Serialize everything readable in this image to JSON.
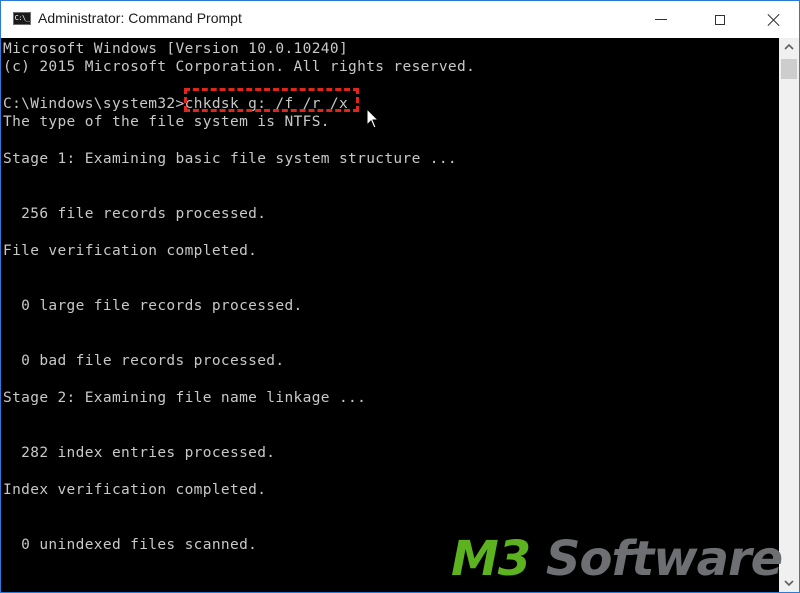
{
  "window": {
    "title": "Administrator: Command Prompt",
    "icon": "cmd-icon",
    "icon_text": "C:\\_",
    "controls": {
      "minimize": "minimize-icon",
      "maximize": "maximize-icon",
      "close": "close-icon"
    }
  },
  "console": {
    "lines": [
      "Microsoft Windows [Version 10.0.10240]",
      "(c) 2015 Microsoft Corporation. All rights reserved.",
      "",
      "C:\\Windows\\system32>chkdsk g: /f /r /x",
      "The type of the file system is NTFS.",
      "",
      "Stage 1: Examining basic file system structure ...",
      "",
      "",
      "  256 file records processed.",
      "",
      "File verification completed.",
      "",
      "",
      "  0 large file records processed.",
      "",
      "",
      "  0 bad file records processed.",
      "",
      "Stage 2: Examining file name linkage ...",
      "",
      "",
      "  282 index entries processed.",
      "",
      "Index verification completed.",
      "",
      "",
      "  0 unindexed files scanned."
    ],
    "prompt": "C:\\Windows\\system32>",
    "command": "chkdsk g: /f /r /x",
    "highlight_color": "#e0251b",
    "text_color": "#c8c8c8",
    "background_color": "#000000"
  },
  "scrollbar": {
    "up_icon": "chevron-up-icon",
    "down_icon": "chevron-down-icon"
  },
  "watermark": {
    "part1": "M3",
    "part2": " Software",
    "part1_color": "#5cb21f",
    "part2_color": "#6d6f72"
  }
}
